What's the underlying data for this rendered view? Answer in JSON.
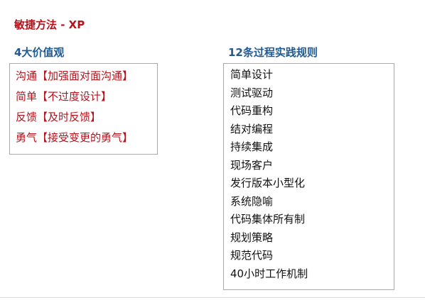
{
  "title": "敏捷方法 - XP",
  "values_section": {
    "heading": "4大价值观",
    "items": [
      "沟通【加强面对面沟通】",
      "简单【不过度设计】",
      "反馈【及时反馈】",
      "勇气【接受变更的勇气】"
    ]
  },
  "rules_section": {
    "heading": "12条过程实践规则",
    "items": [
      "简单设计",
      "测试驱动",
      "代码重构",
      "结对编程",
      "持续集成",
      "现场客户",
      "发行版本小型化",
      "系统隐喻",
      "代码集体所有制",
      "规划策略",
      "规范代码",
      "40小时工作机制"
    ]
  },
  "colors": {
    "title": "#b5121b",
    "heading": "#1f5a93",
    "value_text": "#b5121b",
    "rule_text": "#111111",
    "border": "#a9a9a9"
  }
}
